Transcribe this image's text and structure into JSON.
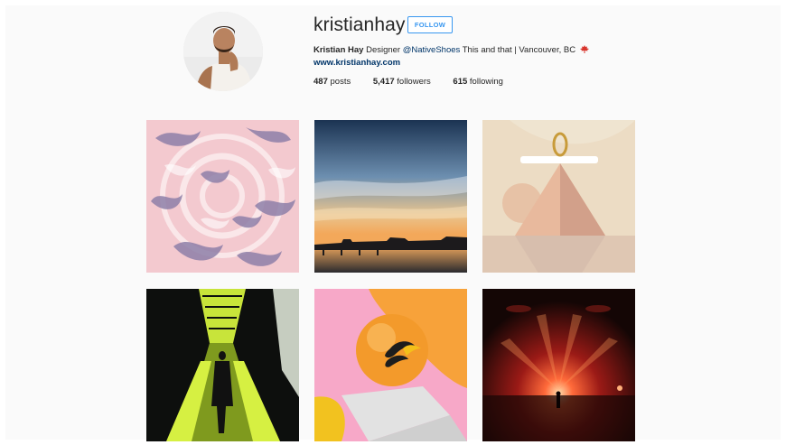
{
  "profile": {
    "username": "kristianhay",
    "follow_label": "FOLLOW",
    "bio": {
      "name": "Kristian Hay",
      "role": "Designer",
      "mention": "@NativeShoes",
      "rest": "This and that | Vancouver, BC",
      "flag_icon": "maple-leaf-icon"
    },
    "website": "www.kristianhay.com",
    "stats": {
      "posts_count": "487",
      "posts_label": "posts",
      "followers_count": "5,417",
      "followers_label": "followers",
      "following_count": "615",
      "following_label": "following"
    }
  },
  "colors": {
    "link_blue": "#003569",
    "button_blue": "#3897f0",
    "background": "#fafafa"
  }
}
